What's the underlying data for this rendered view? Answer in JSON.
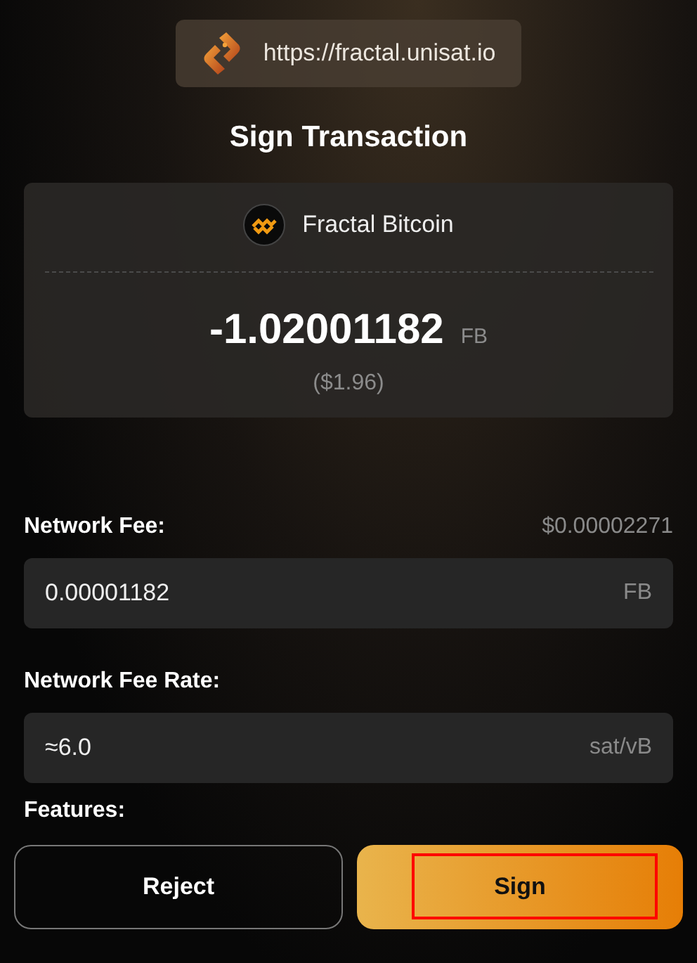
{
  "site": {
    "url": "https://fractal.unisat.io"
  },
  "title": "Sign Transaction",
  "summary": {
    "network": "Fractal Bitcoin",
    "amount": "-1.02001182",
    "unit": "FB",
    "fiat": "($1.96)"
  },
  "fields": [
    {
      "label": "Network Fee:",
      "aside": "$0.00002271",
      "value": "0.00001182",
      "unit": "FB"
    },
    {
      "label": "Network Fee Rate:",
      "value": "≈6.0",
      "unit": "sat/vB"
    }
  ],
  "features": {
    "label": "Features:"
  },
  "buttons": [
    {
      "label": "Reject",
      "kind": "secondary",
      "highlighted": false
    },
    {
      "label": "Sign",
      "kind": "primary",
      "highlighted": true
    }
  ]
}
